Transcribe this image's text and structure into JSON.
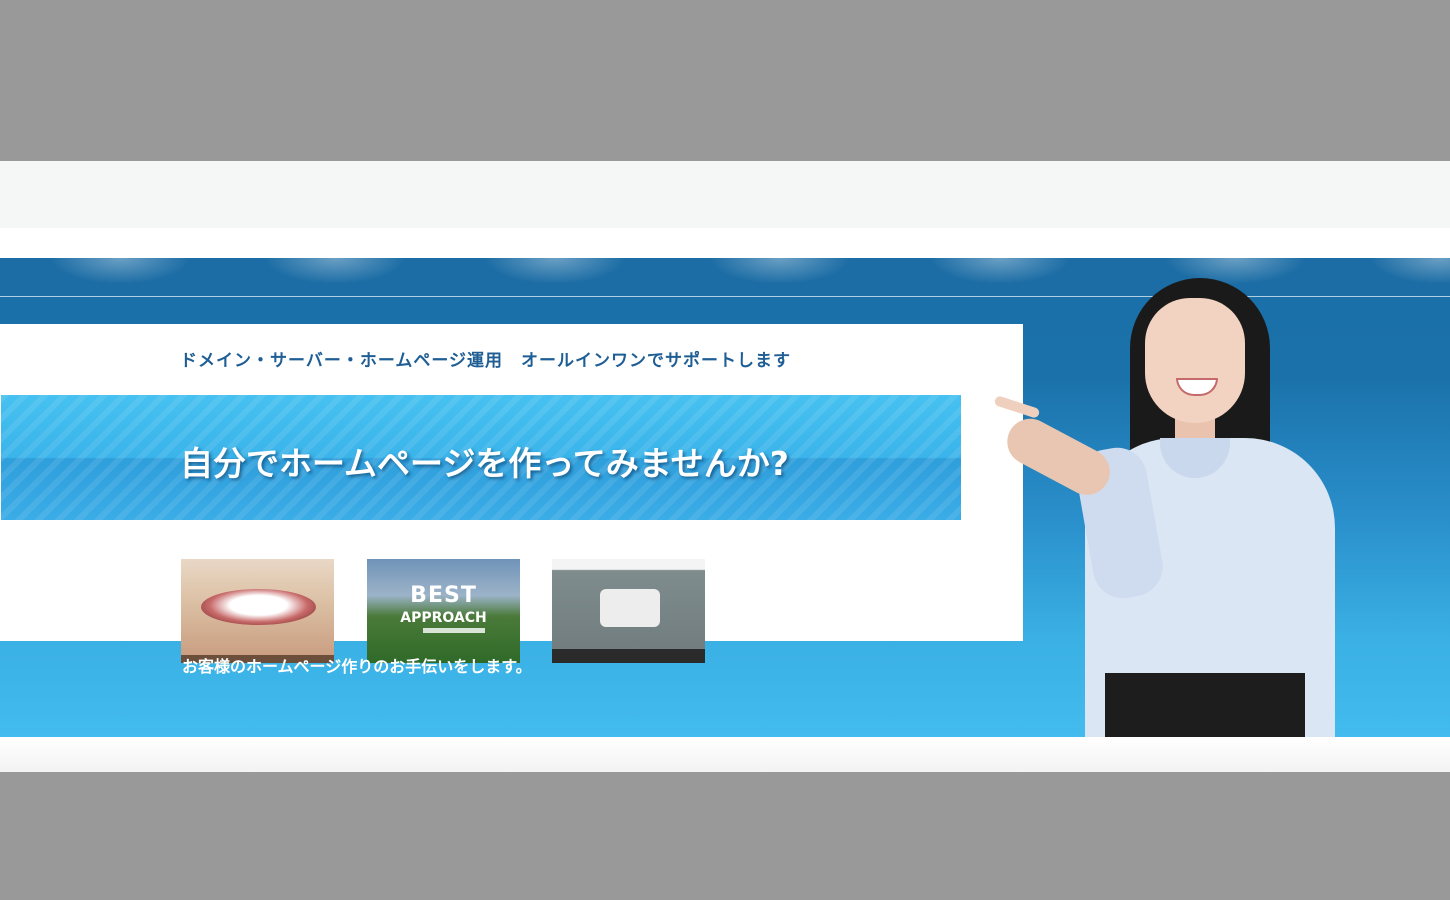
{
  "hero": {
    "tagline": "ドメイン・サーバー・ホームページ運用　オールインワンでサポートします",
    "headline": "自分でホームページを作ってみませんか?",
    "caption": "お客様のホームページ作りのお手伝いをします。"
  },
  "thumbnails": [
    {
      "name": "dental-site"
    },
    {
      "name": "golf-site",
      "text_line1": "BEST",
      "text_line2": "APPROACH"
    },
    {
      "name": "delivery-site"
    }
  ],
  "colors": {
    "banner_top": "#1a6ea7",
    "banner_bottom": "#42bbee",
    "tagline": "#1f5e94",
    "outer_background": "#999999"
  }
}
